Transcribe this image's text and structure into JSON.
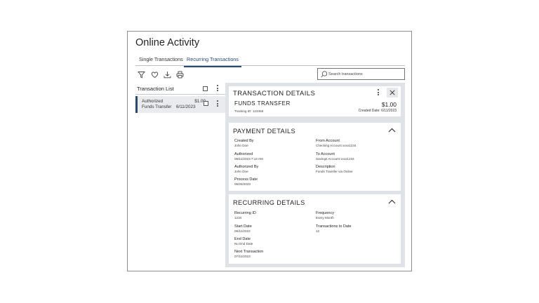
{
  "page": {
    "title": "Online Activity",
    "tabs": [
      {
        "label": "Single Transactions",
        "active": false
      },
      {
        "label": "Recurring Transactions",
        "active": true
      }
    ]
  },
  "toolbar": {
    "icons": [
      "filter-icon",
      "heart-icon",
      "download-icon",
      "print-icon"
    ],
    "search_placeholder": "Search transactions"
  },
  "list": {
    "header": "Transaction List",
    "items": [
      {
        "name": "Authorized Funds Transfer",
        "amount": "$1.00",
        "date": "6/11/2023"
      }
    ]
  },
  "details": {
    "title": "TRANSACTION DETAILS",
    "subheading": "FUNDS TRANSFER",
    "tracking": "Tracking ID: 123456",
    "amount": "$1.00",
    "created": "Created Date: 6/11/2023"
  },
  "payment": {
    "title": "PAYMENT DETAILS",
    "fields": [
      {
        "label": "Created By",
        "value": "John Doe"
      },
      {
        "label": "Authorized",
        "value": "06/11/2023 7:14 AM"
      },
      {
        "label": "Authorized By",
        "value": "John Doe"
      },
      {
        "label": "Process Date",
        "value": "06/25/2023"
      },
      {
        "label": "From Account",
        "value": "Checking Account xxxx1234"
      },
      {
        "label": "To Account",
        "value": "Savings Account xxxx1234"
      },
      {
        "label": "Description",
        "value": "Funds Transfer via Online"
      }
    ]
  },
  "recurring": {
    "title": "RECURRING DETAILS",
    "fields": [
      {
        "label": "Recurring ID",
        "value": "1234"
      },
      {
        "label": "Start Date",
        "value": "06/11/2022"
      },
      {
        "label": "End Date",
        "value": "No End Date"
      },
      {
        "label": "Next Transaction",
        "value": "07/11/2023"
      },
      {
        "label": "Frequency",
        "value": "Every Month"
      },
      {
        "label": "Transactions to Date",
        "value": "12"
      }
    ]
  },
  "colors": {
    "accent": "#2a4a6d",
    "panel_bg": "#dfe2e6",
    "border": "#8a8f96"
  }
}
